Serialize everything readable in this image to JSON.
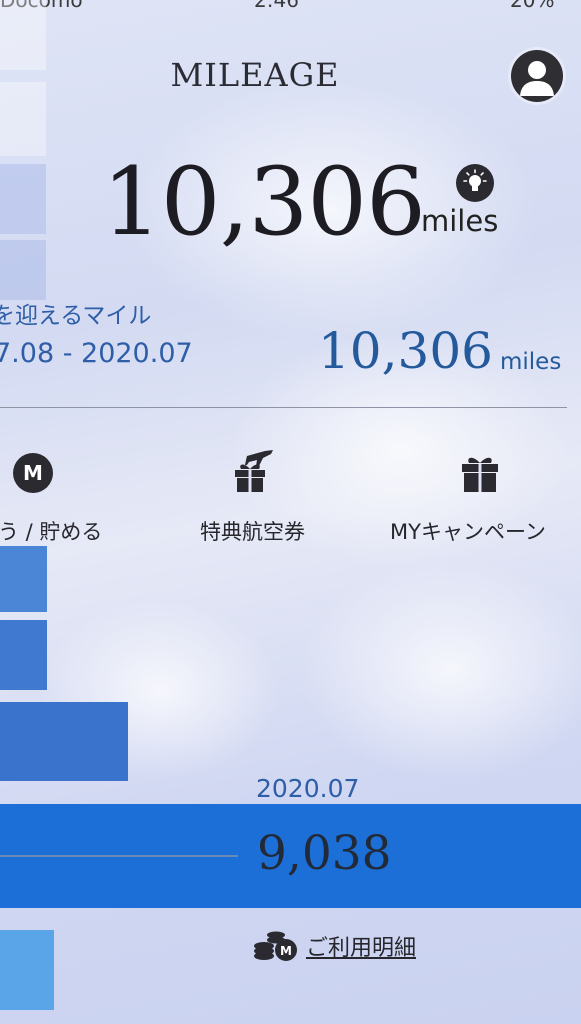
{
  "status_bar": {
    "carrier": "Docomo",
    "time": "2:46",
    "battery": "20%"
  },
  "header": {
    "title": "MILEAGE",
    "profile_icon": "person-icon"
  },
  "total": {
    "value": "10,306",
    "unit": "miles",
    "info_icon": "lightbulb-icon"
  },
  "expiring": {
    "label": "を迎えるマイル",
    "period": "7.08 - 2020.07",
    "value": "10,306",
    "unit": "miles"
  },
  "menu": [
    {
      "label": "う / 貯める",
      "icon": "m-coin-icon"
    },
    {
      "label": "特典航空券",
      "icon": "gift-plane-icon"
    },
    {
      "label": "MYキャンペーン",
      "icon": "gift-icon"
    }
  ],
  "monthly_chart": {
    "selected_month": "2020.07",
    "selected_value": "9,038",
    "bar_color": "#1d6fd8"
  },
  "history": {
    "label": "ご利用明細",
    "icon": "coins-m-icon"
  },
  "colors": {
    "accent_blue": "#245a9c",
    "bar_blue": "#1d6fd8",
    "bar_light": "#4a8fe0"
  }
}
